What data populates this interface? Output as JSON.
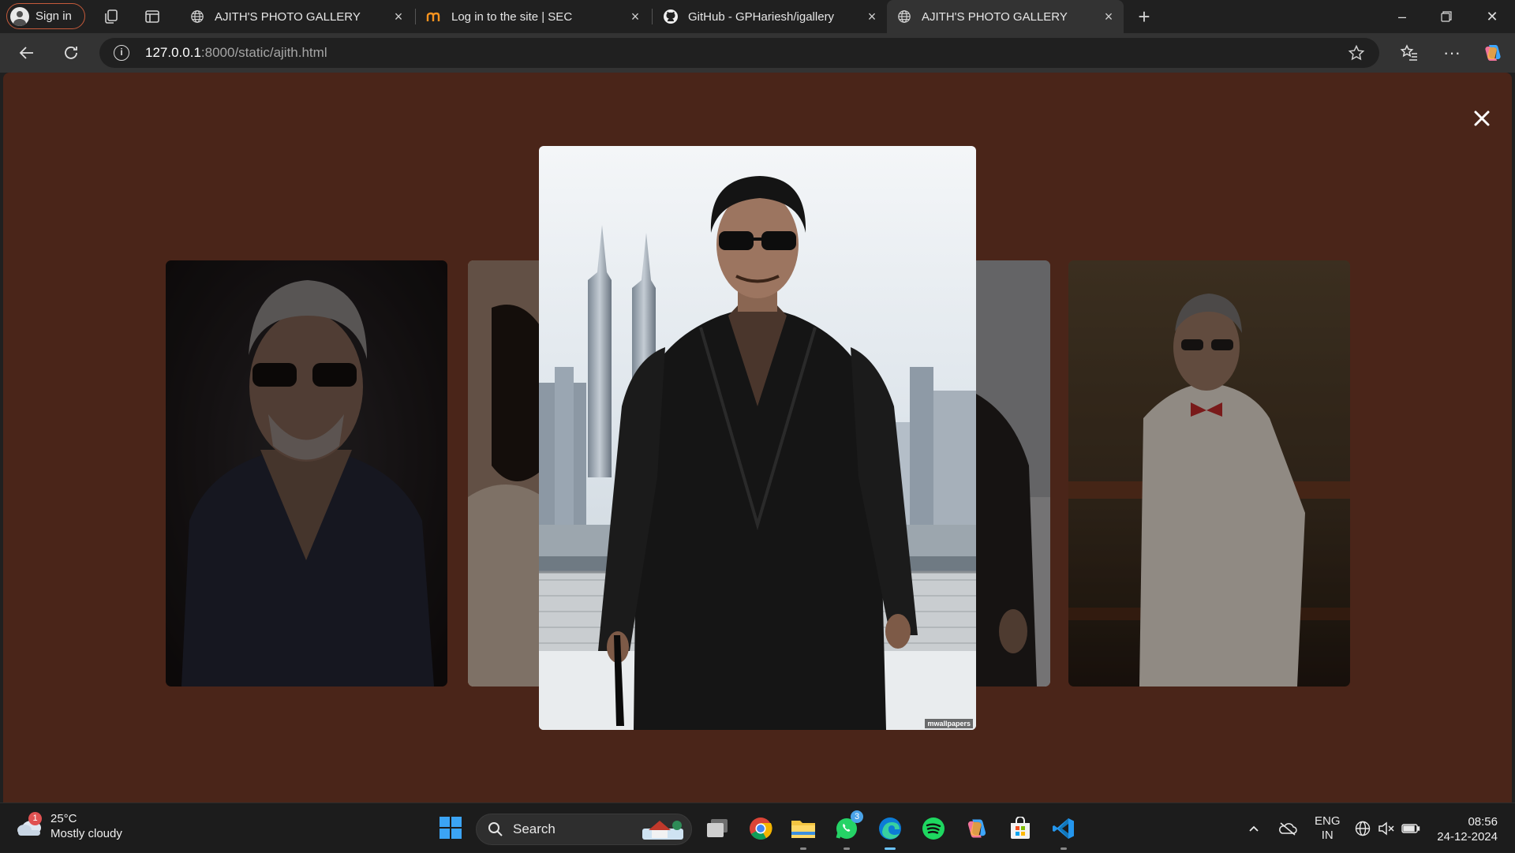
{
  "browser": {
    "profile_button": "Sign in",
    "tabs": [
      {
        "title": "AJITH'S PHOTO GALLERY",
        "favicon": "globe-icon",
        "active": false
      },
      {
        "title": "Log in to the site | SEC",
        "favicon": "moodle-icon",
        "active": false
      },
      {
        "title": "GitHub - GPHariesh/igallery",
        "favicon": "github-icon",
        "active": false
      },
      {
        "title": "AJITH'S PHOTO GALLERY",
        "favicon": "globe-icon",
        "active": true
      }
    ],
    "address": {
      "host": "127.0.0.1",
      "rest": ":8000/static/ajith.html"
    }
  },
  "gallery": {
    "photos": [
      {
        "description": "far-left-photo",
        "watermark": ""
      },
      {
        "description": "left-photo",
        "watermark": ""
      },
      {
        "description": "center-photo",
        "watermark": "mwallpapers"
      },
      {
        "description": "right-photo",
        "watermark": ""
      },
      {
        "description": "far-right-photo",
        "watermark": ""
      }
    ]
  },
  "taskbar": {
    "weather": {
      "badge": "1",
      "temp": "25°C",
      "condition": "Mostly cloudy"
    },
    "search_label": "Search",
    "whatsapp_badge": "3",
    "language": {
      "line1": "ENG",
      "line2": "IN"
    },
    "clock": {
      "time": "08:56",
      "date": "24-12-2024"
    }
  },
  "colors": {
    "page_background": "#4a2519",
    "tab_bar": "#202020",
    "toolbar": "#333333"
  }
}
